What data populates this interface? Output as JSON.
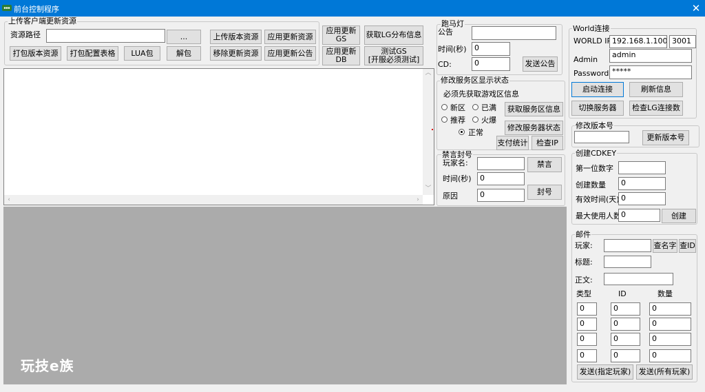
{
  "window": {
    "title": "前台控制程序",
    "close_glyph": "✕"
  },
  "upload_group": {
    "label": "上传客户端更新资源",
    "path_label": "资源路径",
    "path_value": "",
    "browse": "...",
    "upload_version": "上传版本资源",
    "apply_update": "应用更新资源",
    "pack_version": "打包版本资源",
    "pack_config": "打包配置表格",
    "lua_pack": "LUA包",
    "unpack": "解包",
    "remove_update": "移除更新资源",
    "apply_notice": "应用更新公告"
  },
  "mid_buttons": {
    "apply_gs": "应用更新\nGS",
    "get_lg": "获取LG分布信息",
    "apply_db": "应用更新\nDB",
    "test_gs": "测试GS\n[开服必须测试]"
  },
  "marquee": {
    "label": "跑马灯",
    "notice_label": "公告",
    "notice_value": "",
    "time_label": "时间(秒)",
    "time_value": "0",
    "cd_label": "CD:",
    "cd_value": "0",
    "send": "发送公告"
  },
  "server_status": {
    "label": "修改服务区显示状态",
    "hint": "必须先获取游戏区信息",
    "opt_new": "新区",
    "opt_full": "已满",
    "opt_recommend": "推荐",
    "opt_hot": "火爆",
    "opt_normal": "正常",
    "selected": "正常",
    "get_info": "获取服务区信息",
    "modify": "修改服务器状态",
    "pay_stats": "支付统计",
    "check_ip": "检查IP"
  },
  "ban": {
    "label": "禁言封号",
    "player_label": "玩家名:",
    "player_value": "",
    "mute": "禁言",
    "time_label": "时间(秒)",
    "time_value": "0",
    "reason_label": "原因",
    "reason_value": "0",
    "ban": "封号"
  },
  "branding": {
    "logo": "玩技e族"
  },
  "world": {
    "label": "World连接",
    "ip_label": "WORLD IP",
    "ip_value": "192.168.1.100",
    "port_value": "3001",
    "admin_label": "Admin",
    "admin_value": "admin",
    "password_label": "Password",
    "password_value": "*****",
    "start": "启动连接",
    "refresh": "刷新信息",
    "switch": "切换服务器",
    "check_lg": "检查LG连接数"
  },
  "version": {
    "label": "修改版本号",
    "value": "",
    "update": "更新版本号"
  },
  "cdkey": {
    "label": "创建CDKEY",
    "first_digit_label": "第一位数字",
    "first_digit_value": "",
    "count_label": "创建数量",
    "count_value": "0",
    "days_label": "有效时间(天)",
    "days_value": "0",
    "max_users_label": "最大使用人数",
    "max_users_value": "0",
    "create": "创建"
  },
  "mail": {
    "label": "邮件",
    "player_label": "玩家:",
    "player_value": "",
    "find_name": "查名字",
    "find_id": "查ID",
    "title_label": "标题:",
    "title_value": "",
    "body_label": "正文:",
    "body_value": "",
    "col_type": "类型",
    "col_id": "ID",
    "col_qty": "数量",
    "rows": [
      {
        "type": "0",
        "id": "0",
        "qty": "0"
      },
      {
        "type": "0",
        "id": "0",
        "qty": "0"
      },
      {
        "type": "0",
        "id": "0",
        "qty": "0"
      },
      {
        "type": "0",
        "id": "0",
        "qty": "0"
      }
    ],
    "send_one": "发送(指定玩家)",
    "send_all": "发送(所有玩家)"
  }
}
